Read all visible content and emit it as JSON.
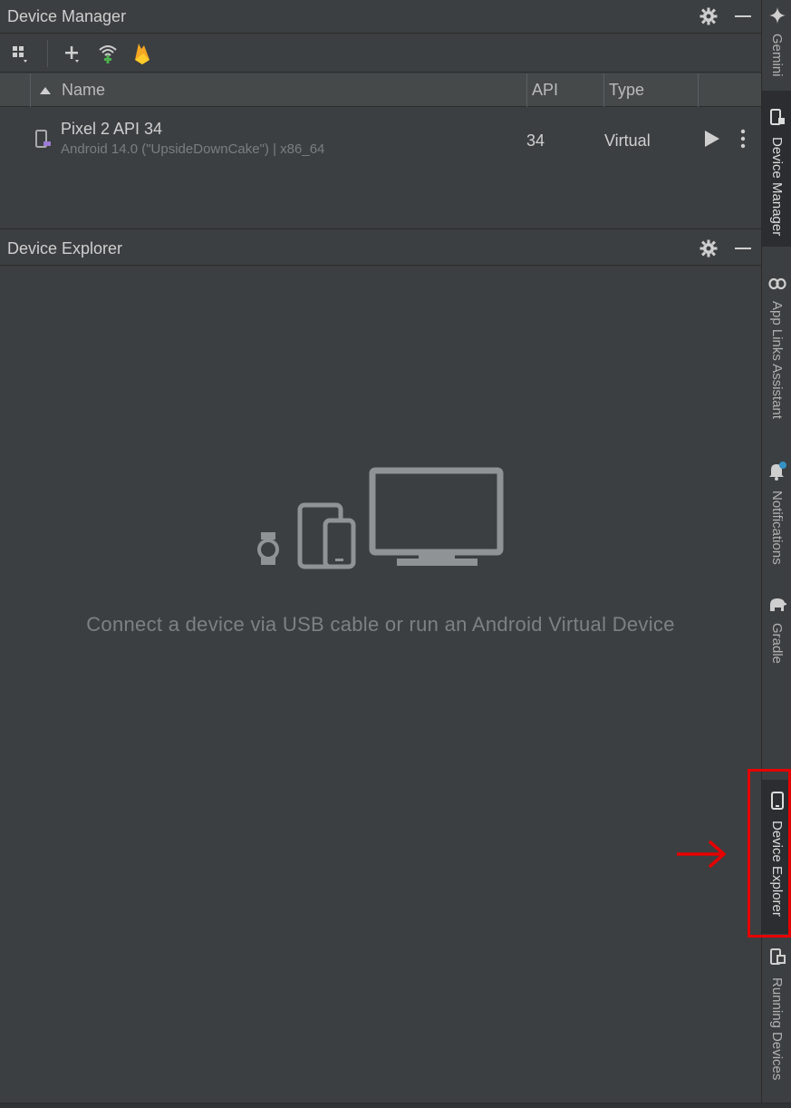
{
  "device_manager": {
    "title": "Device Manager",
    "columns": {
      "name": "Name",
      "api": "API",
      "type": "Type"
    },
    "devices": [
      {
        "name": "Pixel 2 API 34",
        "subtitle": "Android 14.0 (\"UpsideDownCake\") | x86_64",
        "api": "34",
        "type": "Virtual"
      }
    ]
  },
  "device_explorer": {
    "title": "Device Explorer",
    "empty_message": "Connect a device via USB cable or run an Android Virtual Device"
  },
  "sidebar": {
    "items": [
      {
        "label": "Gemini",
        "icon": "sparkle-icon",
        "active": false
      },
      {
        "label": "Device Manager",
        "icon": "device-manager-icon",
        "active": true
      },
      {
        "label": "App Links Assistant",
        "icon": "link-icon",
        "active": false
      },
      {
        "label": "Notifications",
        "icon": "bell-icon",
        "active": false
      },
      {
        "label": "Gradle",
        "icon": "elephant-icon",
        "active": false
      },
      {
        "label": "Device Explorer",
        "icon": "phone-icon",
        "active": true
      },
      {
        "label": "Running Devices",
        "icon": "running-devices-icon",
        "active": false
      }
    ]
  },
  "colors": {
    "background": "#3c3f41",
    "annotation": "#e60000",
    "wifi_green": "#4caf50",
    "firebase_orange": "#f5a623"
  }
}
